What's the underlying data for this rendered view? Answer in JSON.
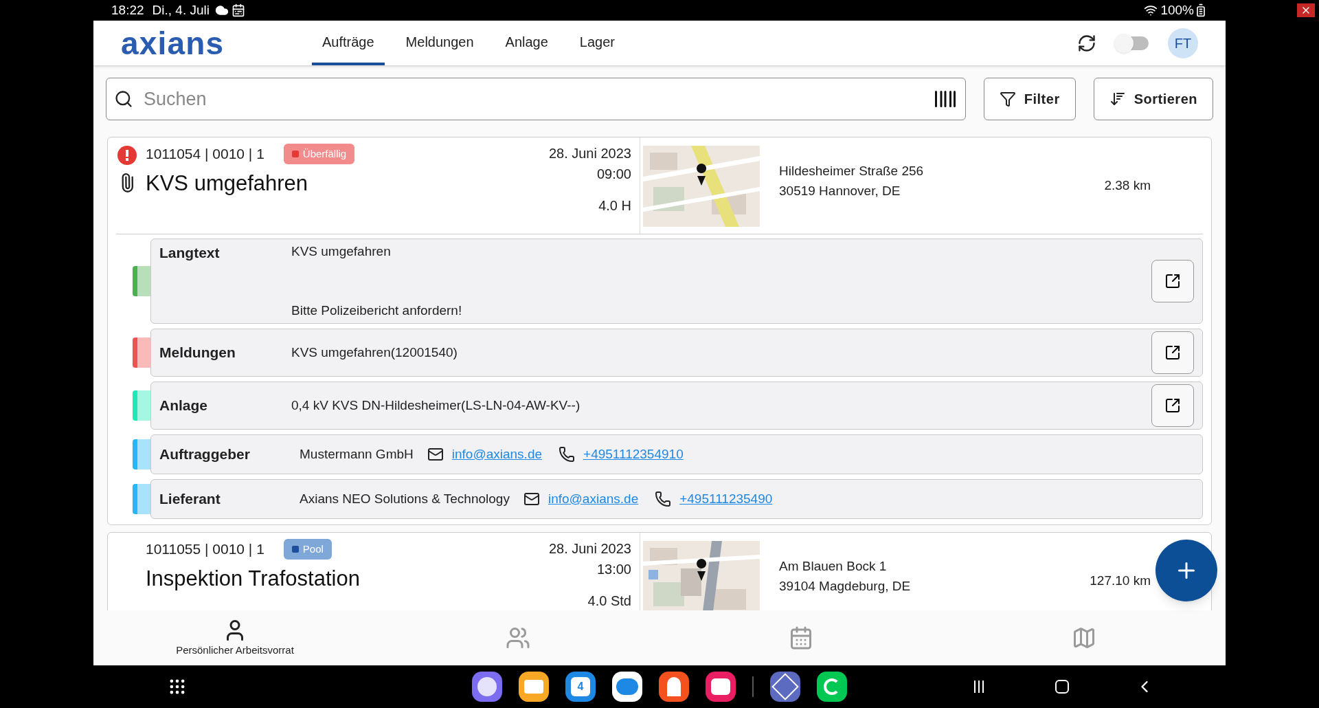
{
  "status_bar": {
    "time": "18:22",
    "date": "Di., 4. Juli",
    "battery": "100%"
  },
  "header": {
    "logo": "axians",
    "tabs": [
      {
        "label": "Aufträge",
        "selected": true
      },
      {
        "label": "Meldungen",
        "selected": false
      },
      {
        "label": "Anlage",
        "selected": false
      },
      {
        "label": "Lager",
        "selected": false
      }
    ],
    "toggle_on": false,
    "avatar": "FT"
  },
  "search": {
    "placeholder": "Suchen"
  },
  "buttons": [
    {
      "kind": "filter",
      "label": "Filter"
    },
    {
      "kind": "sort",
      "label": "Sortieren"
    }
  ],
  "orders": [
    {
      "number": "1011054 | 0010 | 1",
      "status": "Überfällig",
      "color": "#f28b8b",
      "urgent": true,
      "attachment": true,
      "title": "KVS umgefahren",
      "date": "28. Juni 2023",
      "time": "09:00",
      "duration": "4.0 H",
      "street": "Hildesheimer Straße 256",
      "city": "30519 Hannover, DE",
      "distance": "2.38 km",
      "expanded": true,
      "details": [
        {
          "kind": "text",
          "label": "Langtext",
          "color": "#4caf50",
          "lines": [
            "KVS umgefahren",
            "Bitte Polizeibericht anfordern!"
          ],
          "open_button": true
        },
        {
          "kind": "text",
          "label": "Meldungen",
          "color": "#ef5350",
          "lines": [
            "KVS umgefahren(12001540)"
          ],
          "open_button": true
        },
        {
          "kind": "text",
          "label": "Anlage",
          "color": "#1de9b6",
          "lines": [
            "0,4 kV KVS DN-Hildesheimer(LS-LN-04-AW-KV--)"
          ],
          "open_button": true
        },
        {
          "kind": "contact",
          "label": "Auftraggeber",
          "color": "#29b6f6",
          "name": "Mustermann GmbH",
          "email": "info@axians.de",
          "phone": "+4951112354910"
        },
        {
          "kind": "contact",
          "label": "Lieferant",
          "color": "#29b6f6",
          "name": "Axians NEO Solutions & Technology",
          "email": "info@axians.de",
          "phone": "+495111235490"
        }
      ]
    },
    {
      "number": "1011055 | 0010 | 1",
      "status": "Pool",
      "color": "#7fa8d8",
      "urgent": false,
      "attachment": false,
      "title": "Inspektion Trafostation",
      "date": "28. Juni 2023",
      "time": "13:00",
      "duration": "4.0 Std",
      "street": "Am Blauen Bock 1",
      "city": "39104 Magdeburg, DE",
      "distance": "127.10 km",
      "expanded": false
    }
  ],
  "bottom_nav": [
    {
      "kind": "person",
      "label": "Persönlicher Arbeitsvorrat",
      "selected": true
    },
    {
      "kind": "team",
      "selected": false
    },
    {
      "kind": "calendar",
      "selected": false
    },
    {
      "kind": "map",
      "selected": false
    }
  ],
  "dock": [
    {
      "kind": "internet",
      "color": "#7b6cf0"
    },
    {
      "kind": "files",
      "color": "#f9a825"
    },
    {
      "kind": "calendar",
      "color": "#1e88e5",
      "text": "4"
    },
    {
      "kind": "messages",
      "color": "#ffffff"
    },
    {
      "kind": "contacts",
      "color": "#f4511e"
    },
    {
      "kind": "camera",
      "color": "#e91e63"
    },
    {
      "kind": "gallery",
      "color": "#5c6bc0"
    },
    {
      "kind": "phone",
      "color": "#00c853"
    }
  ]
}
